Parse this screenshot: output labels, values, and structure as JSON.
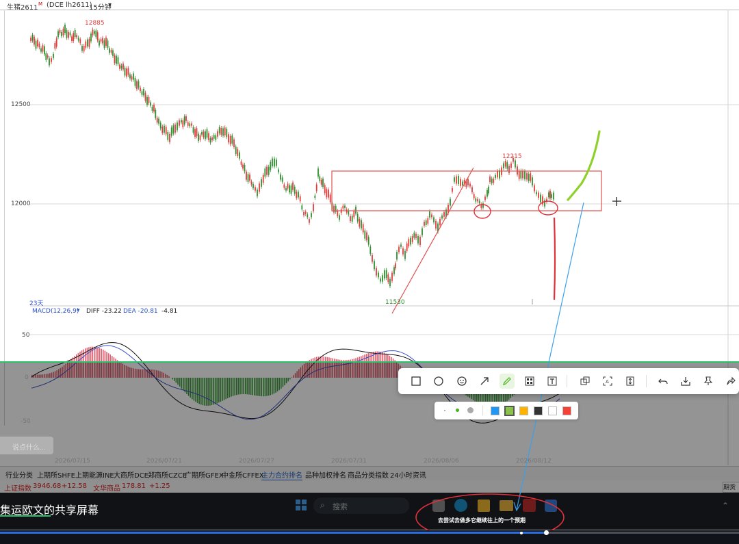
{
  "header": {
    "symbol": "生猪2611",
    "contract": "(DCE lh2611)",
    "period": "15分钟",
    "period_caret": "chevron-down-icon"
  },
  "price_axis": {
    "ticks": [
      "12500",
      "12000"
    ]
  },
  "price_labels": {
    "high": "12885",
    "zone_high": "12215",
    "low": "11530"
  },
  "chart_meta": {
    "days_label": "23天"
  },
  "macd": {
    "name": "MACD(12,26,9)",
    "diff": "DIFF -23.22",
    "dea": "DEA -20.81",
    "hist": "-4.81",
    "ticks": [
      "50",
      "0",
      "-50"
    ]
  },
  "date_axis": [
    "2026/07/15",
    "2026/07/21",
    "2026/07/27",
    "2026/07/31",
    "2026/08/06",
    "2026/08/12"
  ],
  "tabs": [
    {
      "label": "行业分类"
    },
    {
      "label": "上期所SHFE"
    },
    {
      "label": "上期能源INE"
    },
    {
      "label": "大商所DCE"
    },
    {
      "label": "郑商所CZCE"
    },
    {
      "label": "广期所GFEX"
    },
    {
      "label": "中金所CFFEX"
    },
    {
      "label": "主力合约排名"
    },
    {
      "label": "品种加权排名"
    },
    {
      "label": "商品分类指数"
    },
    {
      "label": "24小时资讯"
    }
  ],
  "index_bar": {
    "idx1_name": "上证指数",
    "idx1_value": "3946.68",
    "idx1_change": "+12.58",
    "idx2_name": "文华商品",
    "idx2_value": "178.81",
    "idx2_change": "+1.25",
    "right_button": "期货"
  },
  "hint": {
    "text": "说点什么..."
  },
  "share": {
    "caption": "集运欧文的共享屏幕"
  },
  "taskbar": {
    "search_placeholder": "搜索"
  },
  "annotation": {
    "text": "去尝试去做多它继续往上的一个预期"
  },
  "toolbar": {
    "icons": [
      "rectangle-icon",
      "circle-icon",
      "emoji-icon",
      "arrow-icon",
      "pencil-icon",
      "mosaic-icon",
      "text-icon",
      "pin-screen-icon",
      "ocr-icon",
      "long-capture-icon",
      "undo-icon",
      "save-icon",
      "pin-icon",
      "share-icon"
    ]
  },
  "palette": {
    "colors": [
      "#2196f3",
      "#8bc34a",
      "#ffb300",
      "#333333",
      "#ffffff",
      "#f44336"
    ],
    "selected": "#8bc34a"
  },
  "colors": {
    "up": "#e03c3c",
    "down": "#2f8f2f",
    "grid": "#d8d8d8",
    "zone": "#e05050",
    "annotation_red": "#e0303a",
    "annotation_green": "#8fd12a",
    "annotation_blue": "#3aa0ea"
  }
}
